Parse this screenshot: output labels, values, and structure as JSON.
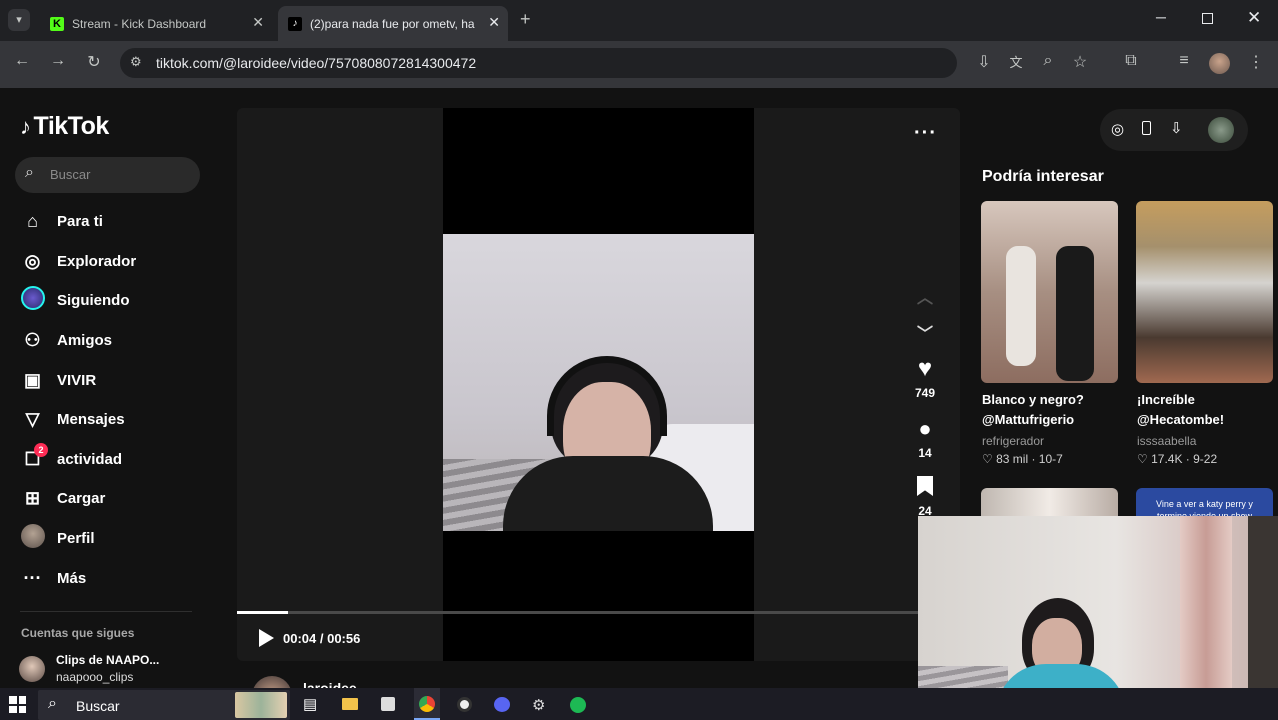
{
  "browser": {
    "tabs": [
      {
        "title": "Stream - Kick Dashboard"
      },
      {
        "title": "(2)para nada fue por ometv, ha"
      }
    ],
    "url": "tiktok.com/@laroidee/video/7570808072814300472"
  },
  "sidebar": {
    "logo": "TikTok",
    "search_placeholder": "Buscar",
    "items": [
      {
        "label": "Para ti"
      },
      {
        "label": "Explorador"
      },
      {
        "label": "Siguiendo"
      },
      {
        "label": "Amigos"
      },
      {
        "label": "VIVIR"
      },
      {
        "label": "Mensajes"
      },
      {
        "label": "actividad",
        "badge": "2"
      },
      {
        "label": "Cargar"
      },
      {
        "label": "Perfil"
      },
      {
        "label": "Más"
      }
    ],
    "following_title": "Cuentas que sigues",
    "following": [
      {
        "name": "Clips de NAAPO...",
        "handle": "naapooo_clips"
      }
    ]
  },
  "video": {
    "time": "00:04 / 00:56",
    "progress": 0.07,
    "likes": "749",
    "comments": "14",
    "saves": "24",
    "author": "laroidee"
  },
  "recommendations": {
    "title": "Podría interesar",
    "cards": [
      {
        "title_line1": "Blanco y negro?",
        "title_line2": "@Mattufrigerio",
        "user": "refrigerador",
        "stats": "83 mil · 10-7"
      },
      {
        "title_line1": "¡Increíble",
        "title_line2": "@Hecatombe!",
        "user": "isssaabella",
        "stats": "17.4K · 9-22"
      },
      {
        "caption": "Vine a ver a katy perry y termine viendo un show"
      }
    ]
  },
  "taskbar": {
    "search_label": "Buscar"
  },
  "colors": {
    "tiktok_bg": "#121212",
    "chrome_dark": "#202124",
    "accent_red": "#fe2c55"
  }
}
